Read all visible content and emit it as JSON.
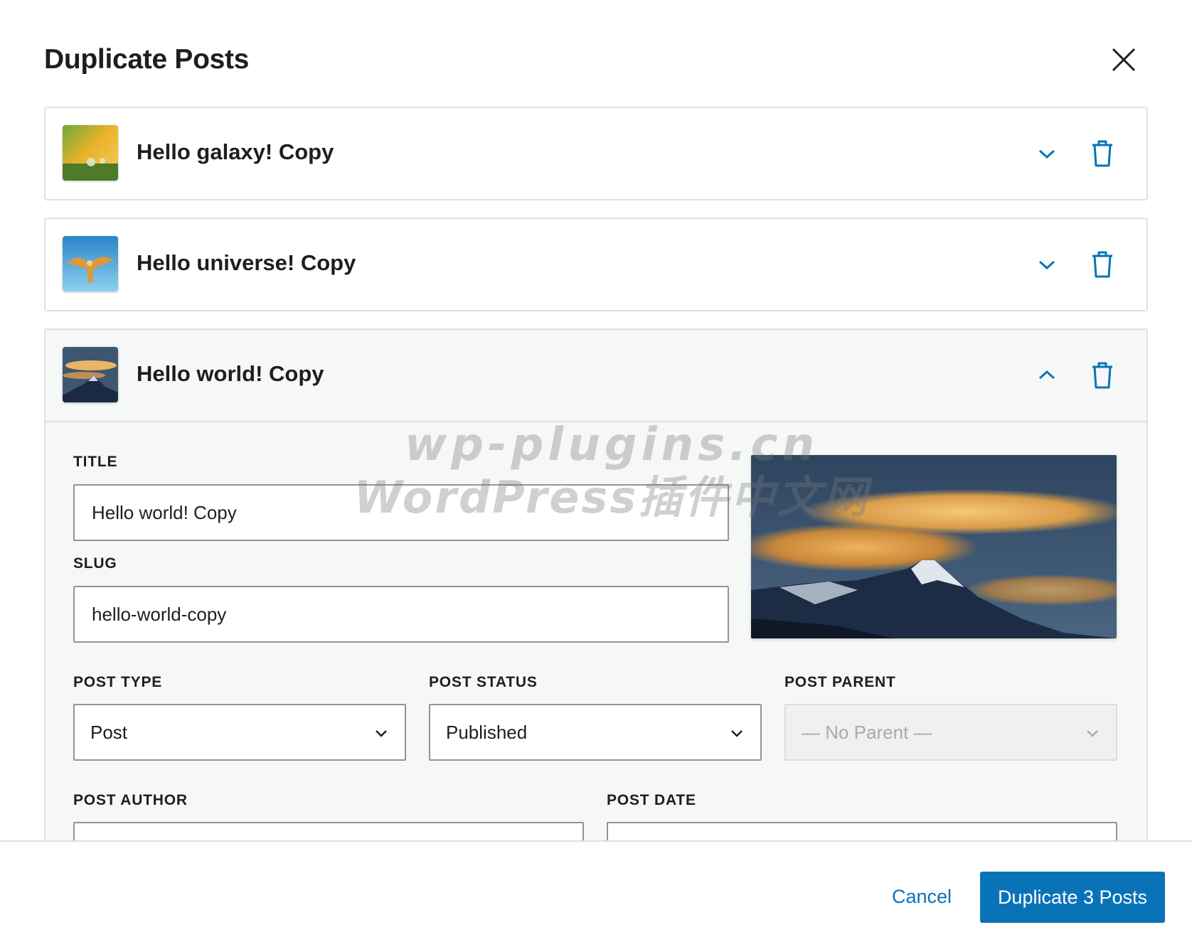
{
  "modal": {
    "title": "Duplicate Posts"
  },
  "posts": [
    {
      "title": "Hello galaxy! Copy",
      "expanded": false
    },
    {
      "title": "Hello universe! Copy",
      "expanded": false
    },
    {
      "title": "Hello world! Copy",
      "expanded": true
    }
  ],
  "editor": {
    "title_label": "TITLE",
    "title_value": "Hello world! Copy",
    "slug_label": "SLUG",
    "slug_value": "hello-world-copy",
    "post_type_label": "POST TYPE",
    "post_type_value": "Post",
    "post_status_label": "POST STATUS",
    "post_status_value": "Published",
    "post_parent_label": "POST PARENT",
    "post_parent_value": "— No Parent —",
    "post_author_label": "POST AUTHOR",
    "post_date_label": "POST DATE"
  },
  "watermark": {
    "line1": "wp-plugins.cn",
    "line2": "WordPress插件中文网"
  },
  "footer": {
    "cancel_label": "Cancel",
    "submit_label": "Duplicate 3 Posts"
  },
  "colors": {
    "accent": "#0a73b8",
    "border": "#e0e0e0",
    "expanded_bg": "#f6f7f7"
  },
  "icons": {
    "close": "close-icon",
    "expand": "chevron-down-icon",
    "collapse": "chevron-up-icon",
    "delete": "trash-icon",
    "select_caret": "chevron-down-icon"
  }
}
